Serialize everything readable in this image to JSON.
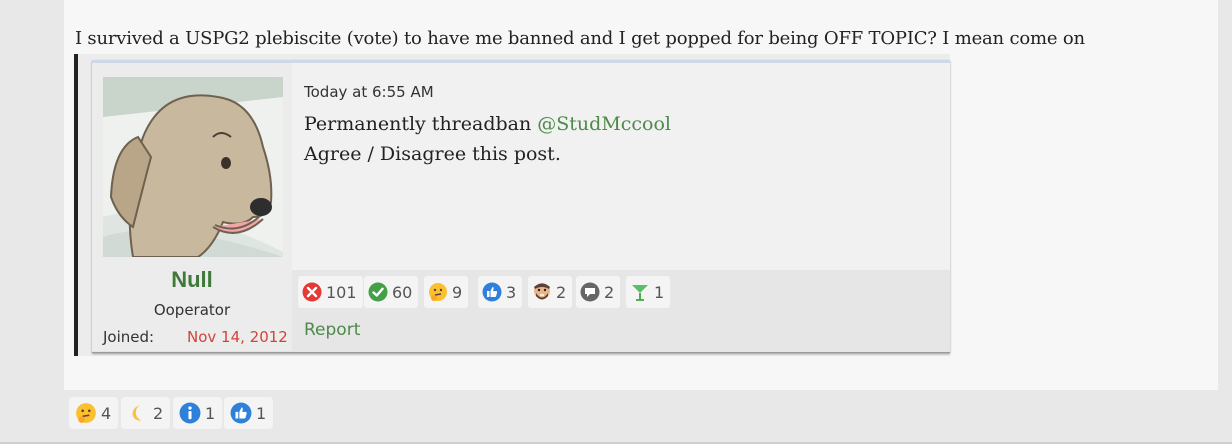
{
  "post": {
    "text": "I survived a USPG2 plebiscite (vote) to have me banned and I get popped for being OFF TOPIC? I mean come on"
  },
  "quoted": {
    "username": "Null",
    "user_title": "Ooperator",
    "joined_label": "Joined:",
    "joined_date": "Nov 14, 2012",
    "timestamp": "Today at 6:55 AM",
    "line1_prefix": "Permanently threadban ",
    "mention": "@StudMccool",
    "line2": "Agree / Disagree this post.",
    "report_label": "Report",
    "reactions": [
      {
        "icon": "red-x-icon",
        "count": "101"
      },
      {
        "icon": "green-check-icon",
        "count": "60"
      },
      {
        "icon": "thinking-face-icon",
        "count": "9"
      },
      {
        "icon": "thumbs-up-icon",
        "count": "3"
      },
      {
        "icon": "bearded-face-icon",
        "count": "2"
      },
      {
        "icon": "speech-bubble-icon",
        "count": "2"
      },
      {
        "icon": "cocktail-glass-icon",
        "count": "1"
      }
    ]
  },
  "reactions": [
    {
      "icon": "thinking-face-icon",
      "count": "4"
    },
    {
      "icon": "crescent-moon-icon",
      "count": "2"
    },
    {
      "icon": "info-icon",
      "count": "1"
    },
    {
      "icon": "thumbs-up-icon",
      "count": "1"
    }
  ],
  "colors": {
    "username": "#3f7a3a",
    "joined_date": "#d2433a",
    "link": "#4d8a4a",
    "like_blue": "#2f80d8",
    "disagree_red": "#e53935",
    "agree_green": "#43a047"
  }
}
